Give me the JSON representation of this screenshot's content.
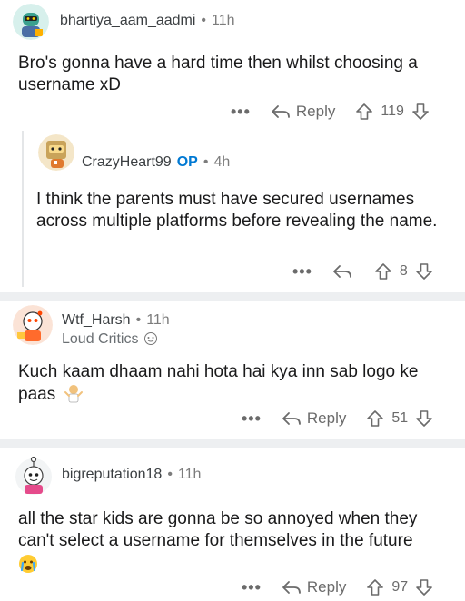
{
  "comments": [
    {
      "username": "bhartiya_aam_aadmi",
      "time": "11h",
      "body": "Bro's gonna have a hard time then whilst choosing a username xD",
      "reply_label": "Reply",
      "votes": "119"
    },
    {
      "username": "CrazyHeart99",
      "op_badge": "OP",
      "time": "4h",
      "body": "I think the parents must have secured usernames across multiple platforms before revealing the name.",
      "votes": "8"
    },
    {
      "username": "Wtf_Harsh",
      "time": "11h",
      "flair": "Loud Critics",
      "body": "Kuch kaam dhaam nahi hota hai kya inn sab logo ke paas",
      "reply_label": "Reply",
      "votes": "51"
    },
    {
      "username": "bigreputation18",
      "time": "11h",
      "body": "all the star kids are gonna be so annoyed when they can't select a username for themselves in the future",
      "reply_label": "Reply",
      "votes": "97"
    }
  ],
  "separator": "•",
  "more_label": "•••",
  "colors": {
    "op": "#0079d3",
    "separator_bg": "#edeff1",
    "meta": "#7c7c7c"
  },
  "icons": {
    "reply": "reply-arrow-icon",
    "upvote": "upvote-arrow-icon",
    "downvote": "downvote-arrow-icon",
    "more": "more-dots-icon",
    "emoji_shrug": "shrug-emoji-icon",
    "emoji_crying": "crying-emoji-icon",
    "flair_emoji": "flair-emoji-icon"
  }
}
